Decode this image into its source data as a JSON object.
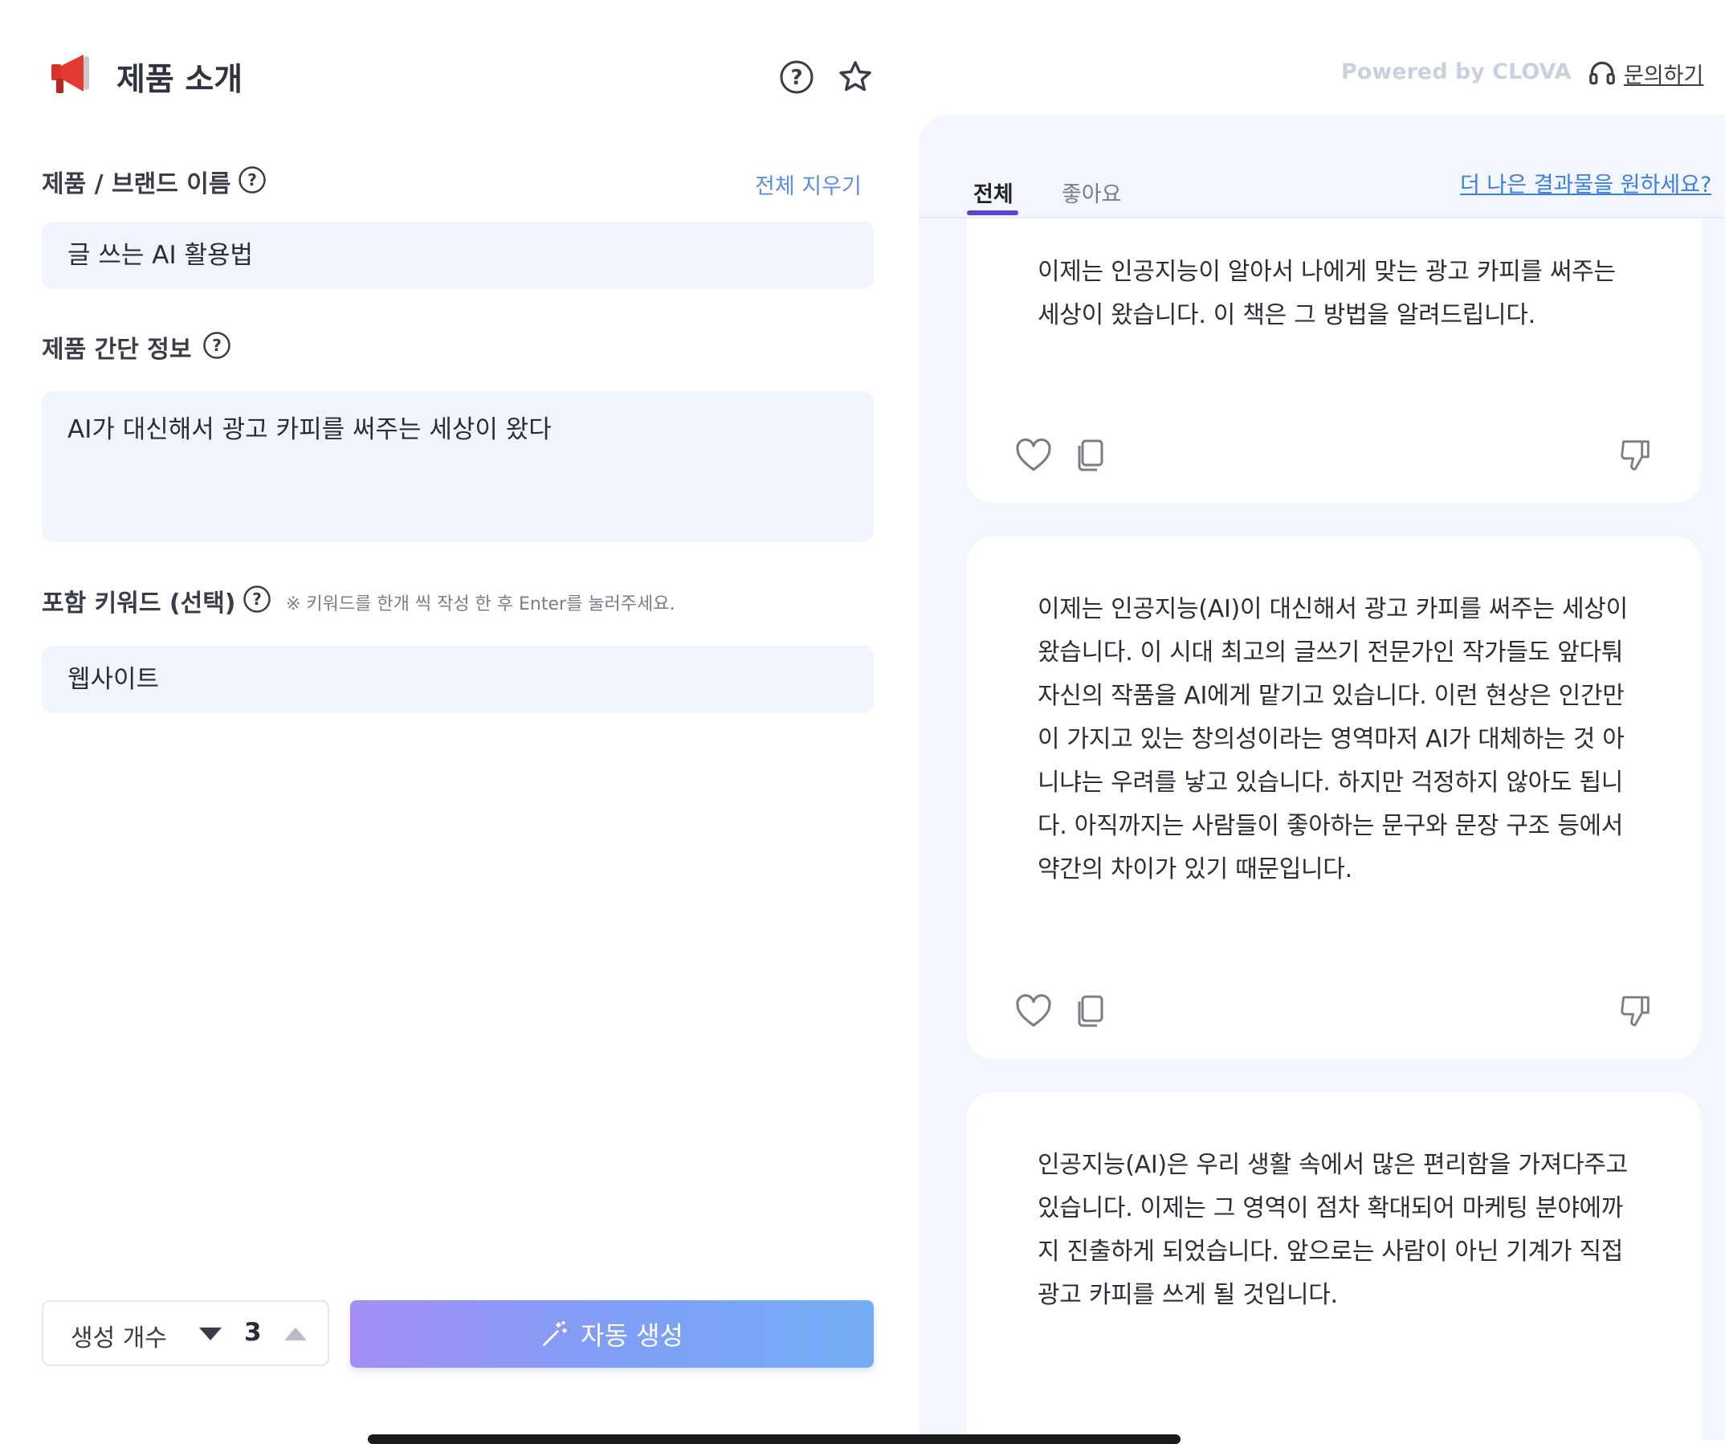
{
  "header": {
    "title": "제품 소개",
    "powered_by": "Powered by CLOVA",
    "contact_label": "문의하기"
  },
  "form": {
    "brand_label": "제품 / 브랜드 이름",
    "clear_all": "전체 지우기",
    "brand_value": "글 쓰는 AI 활용법",
    "info_label": "제품 간단 정보",
    "info_value": "AI가 대신해서 광고 카피를 써주는 세상이 왔다",
    "keyword_label": "포함 키워드 (선택)",
    "keyword_hint": "※ 키워드를 한개 씩 작성 한 후 Enter를 눌러주세요.",
    "keyword_value": "웹사이트"
  },
  "footer": {
    "count_label": "생성 개수",
    "count_value": "3",
    "generate_label": "자동 생성"
  },
  "results": {
    "tabs": [
      "전체",
      "좋아요"
    ],
    "active_tab": 0,
    "better_link": "더 나은 결과물을 원하세요?",
    "cards": [
      {
        "lines": [
          "이제는 인공지능이 알아서 나에게 맞는 광고 카피를 써주는",
          "세상이 왔습니다. 이 책은 그 방법을 알려드립니다."
        ]
      },
      {
        "lines": [
          "이제는 인공지능(AI)이 대신해서 광고 카피를 써주는 세상이",
          "왔습니다. 이 시대 최고의 글쓰기 전문가인 작가들도 앞다퉈",
          "자신의 작품을 AI에게 맡기고 있습니다. 이런 현상은 인간만",
          "이 가지고 있는 창의성이라는 영역마저 AI가 대체하는 것 아",
          "니냐는 우려를 낳고 있습니다. 하지만 걱정하지 않아도 됩니",
          "다. 아직까지는 사람들이 좋아하는 문구와 문장 구조 등에서",
          "약간의 차이가 있기 때문입니다."
        ]
      },
      {
        "lines": [
          "인공지능(AI)은 우리 생활 속에서 많은 편리함을 가져다주고",
          "있습니다. 이제는 그 영역이 점차 확대되어 마케팅 분야에까",
          "지 진출하게 되었습니다. 앞으로는 사람이 아닌 기계가 직접",
          "광고 카피를 쓰게 될 것입니다."
        ]
      }
    ]
  },
  "colors": {
    "accent_purple": "#5b44c9",
    "link_blue": "#3b7ee6",
    "field_bg": "#f0f5fd",
    "panel_bg": "#f3f6fc"
  }
}
